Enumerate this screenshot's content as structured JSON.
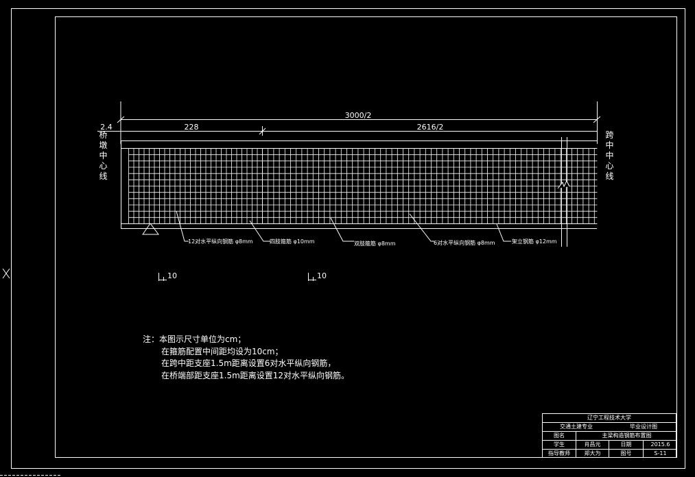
{
  "drawing": {
    "dim_total": "3000/2",
    "dim_left_offset": "2.4",
    "dim_support_zone": "228",
    "dim_middle_zone": "2616/2",
    "left_label": "桥墩中心线",
    "right_label": "跨中中心线",
    "callouts": [
      "12对水平纵向钢筋 φ8mm",
      "四肢箍筋 φ10mm",
      "双肢箍筋 φ8mm",
      "6对水平纵向钢筋 φ8mm",
      "架立钢筋 φ12mm"
    ],
    "section_marks": [
      "10",
      "10"
    ]
  },
  "notes": {
    "line1": "注：本图示尺寸单位为cm；",
    "line2": "在箍筋配置中间距均设为10cm；",
    "line3": "在跨中距支座1.5m距离设置6对水平纵向钢筋，",
    "line4": "在桥端部距支座1.5m距离设置12对水平纵向钢筋。"
  },
  "title_block": {
    "school": "辽宁工程技术大学",
    "major": "交通土建专业",
    "doc_type": "毕业设计图",
    "drawing_name_label": "图名",
    "drawing_name": "主梁构造钢筋布置图",
    "student_label": "学生",
    "student": "肖昌元",
    "date_label": "日期",
    "date": "2015.6",
    "advisor_label": "指导教师",
    "advisor": "郑大为",
    "drawing_no_label": "图号",
    "drawing_no": "S-11"
  }
}
